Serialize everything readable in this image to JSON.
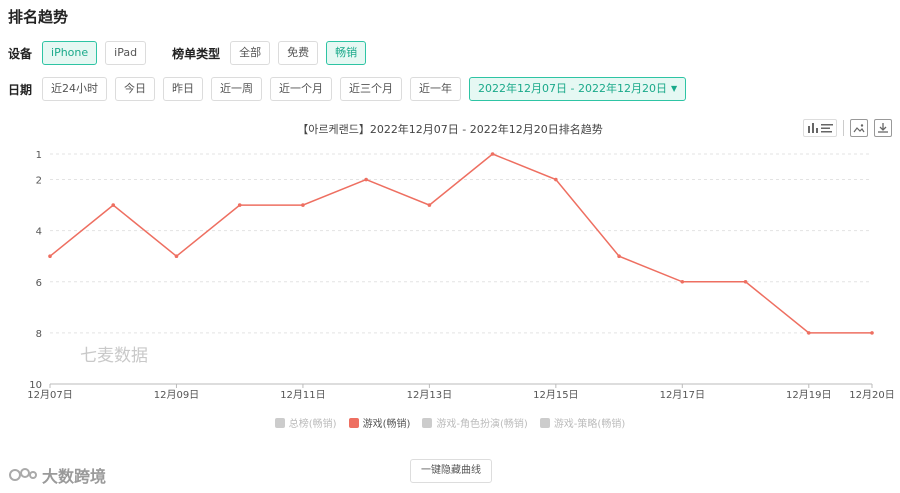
{
  "page_title": "排名趋势",
  "device": {
    "label": "设备",
    "options": [
      "iPhone",
      "iPad"
    ],
    "active": 0
  },
  "list_type": {
    "label": "榜单类型",
    "options": [
      "全部",
      "免费",
      "畅销"
    ],
    "active": 2
  },
  "date": {
    "label": "日期",
    "options": [
      "近24小时",
      "今日",
      "昨日",
      "近一周",
      "近一个月",
      "近三个月",
      "近一年"
    ],
    "range": "2022年12月07日 - 2022年12月20日"
  },
  "chart_data": {
    "type": "line",
    "title": "【아르케랜드】2022年12月07日 - 2022年12月20日排名趋势",
    "categories": [
      "12月07日",
      "12月08日",
      "12月09日",
      "12月10日",
      "12月11日",
      "12月12日",
      "12月13日",
      "12月14日",
      "12月15日",
      "12月16日",
      "12月17日",
      "12月18日",
      "12月19日",
      "12月20日"
    ],
    "x_tick_labels": [
      "12月07日",
      "12月09日",
      "12月11日",
      "12月13日",
      "12月15日",
      "12月17日",
      "12月19日",
      "12月20日"
    ],
    "x_tick_index": [
      0,
      2,
      4,
      6,
      8,
      10,
      12,
      13
    ],
    "y_ticks": [
      1,
      2,
      4,
      6,
      8,
      10
    ],
    "ylim": [
      1,
      10
    ],
    "y_inverted": true,
    "grid": "horizontal-dashed",
    "series": [
      {
        "name": "游戏(畅销)",
        "color": "#ee6f61",
        "values": [
          5,
          3,
          5,
          3,
          3,
          2,
          3,
          1,
          2,
          5,
          6,
          6,
          8,
          8
        ]
      }
    ],
    "legend": [
      {
        "name": "总榜(畅销)",
        "active": false
      },
      {
        "name": "游戏(畅销)",
        "active": true
      },
      {
        "name": "游戏-角色扮演(畅销)",
        "active": false
      },
      {
        "name": "游戏-策略(畅销)",
        "active": false
      }
    ],
    "watermark": "七麦数据"
  },
  "hide_all_label": "一键隐藏曲线",
  "brand_text": "大数跨境"
}
